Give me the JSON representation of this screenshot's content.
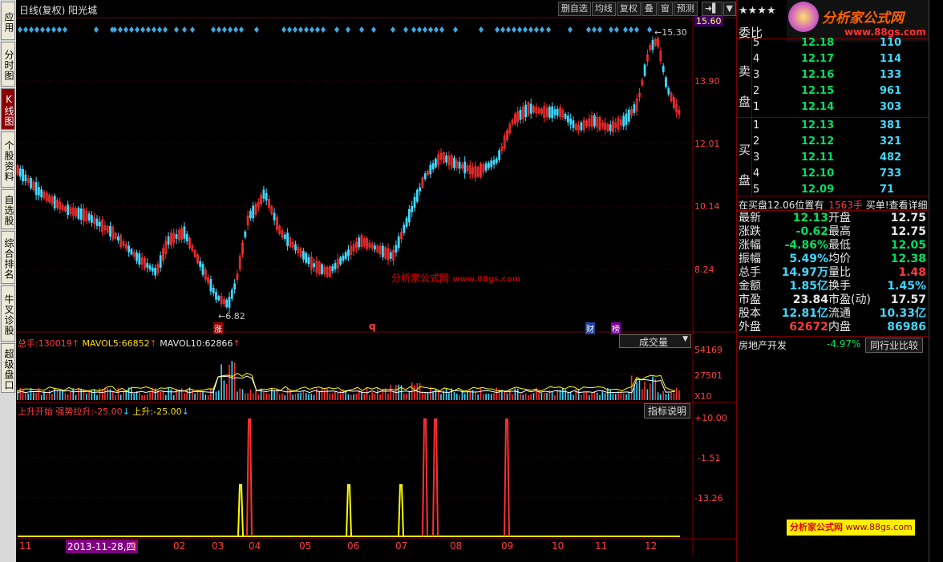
{
  "left_tabs": [
    "应用",
    "分时图",
    "K线图",
    "个股资料",
    "自选股",
    "综合排名",
    "牛叉诊股",
    "超级盘口"
  ],
  "header": {
    "title": "日线(复权) 阳光城",
    "toolbar": [
      "删自选",
      "均线",
      "复权",
      "叠",
      "窗",
      "预测"
    ]
  },
  "price_axis": [
    "15.60",
    "13.90",
    "12.01",
    "10.14",
    "8.24"
  ],
  "price_annotations": {
    "high": "15.30",
    "low": "6.82"
  },
  "event_marks": {
    "zhang": "涨",
    "q": "q",
    "cai": "财",
    "bang": "榜"
  },
  "volume_panel": {
    "title_prefix": "总手:",
    "total": "130019",
    "mavol5_label": "MAVOL5:",
    "mavol5": "66852",
    "mavol10_label": "MAVOL10:",
    "mavol10": "62866",
    "dropdown": "成交量",
    "axis": [
      "54169",
      "27501",
      "X10"
    ]
  },
  "indicator_panel": {
    "name": "上升开始",
    "s1_label": "强势拉升:",
    "s1_val": "-25.00",
    "s2_label": "上升:",
    "s2_val": "-25.00",
    "help_button": "指标说明",
    "axis": [
      "+10.00",
      "-1.51",
      "-13.26"
    ]
  },
  "date_axis": {
    "cursor_date": "2013-11-28,四",
    "labels": [
      "11",
      "1",
      "02",
      "03",
      "04",
      "05",
      "06",
      "07",
      "08",
      "09",
      "10",
      "11",
      "12"
    ]
  },
  "watermark": {
    "site": "分析家公式网",
    "url": "www.88gs.com"
  },
  "right_panel": {
    "stars": "★★★★",
    "logo_text": "分析家公式网",
    "logo_url": "www.88gs.com",
    "weibi_label": "委比",
    "sell_label": "卖盘",
    "buy_label": "买盘",
    "sells": [
      {
        "lvl": "5",
        "price": "12.18",
        "vol": "110"
      },
      {
        "lvl": "4",
        "price": "12.17",
        "vol": "114"
      },
      {
        "lvl": "3",
        "price": "12.16",
        "vol": "133"
      },
      {
        "lvl": "2",
        "price": "12.15",
        "vol": "961"
      },
      {
        "lvl": "1",
        "price": "12.14",
        "vol": "303"
      }
    ],
    "buys": [
      {
        "lvl": "1",
        "price": "12.13",
        "vol": "381"
      },
      {
        "lvl": "2",
        "price": "12.12",
        "vol": "321"
      },
      {
        "lvl": "3",
        "price": "12.11",
        "vol": "482"
      },
      {
        "lvl": "4",
        "price": "12.10",
        "vol": "733"
      },
      {
        "lvl": "5",
        "price": "12.09",
        "vol": "71"
      }
    ],
    "notice": {
      "text1": "在买盘12.06位置有",
      "qty": "1563手",
      "text2": "买单!",
      "link": "查看详细"
    },
    "stats": [
      {
        "l1": "最新",
        "v1": "12.13",
        "l2": "开盘",
        "v2": "12.75"
      },
      {
        "l1": "涨跌",
        "v1": "-0.62",
        "l2": "最高",
        "v2": "12.75"
      },
      {
        "l1": "涨幅",
        "v1": "-4.86%",
        "l2": "最低",
        "v2": "12.05"
      },
      {
        "l1": "振幅",
        "v1": "5.49%",
        "l2": "均价",
        "v2": "12.38"
      },
      {
        "l1": "总手",
        "v1": "14.97万",
        "l2": "量比",
        "v2": "1.48"
      },
      {
        "l1": "金额",
        "v1": "1.85亿",
        "l2": "换手",
        "v2": "1.45%"
      },
      {
        "l1": "市盈",
        "v1": "23.84",
        "l2": "市盈(动)",
        "v2": "17.57"
      },
      {
        "l1": "股本",
        "v1": "12.81亿",
        "l2": "流通",
        "v2": "10.33亿"
      },
      {
        "l1": "外盘",
        "v1": "62672",
        "l2": "内盘",
        "v2": "86986"
      }
    ],
    "sector": {
      "name": "房地产开发",
      "change": "-4.97%",
      "button": "同行业比较"
    },
    "bottom_banner": {
      "site": "分析家公式网",
      "url": "www.88gs.com"
    }
  },
  "colors": {
    "up": "#ff3030",
    "down": "#40d8ff",
    "yellow": "#ffff00",
    "grid": "#5a0000"
  }
}
